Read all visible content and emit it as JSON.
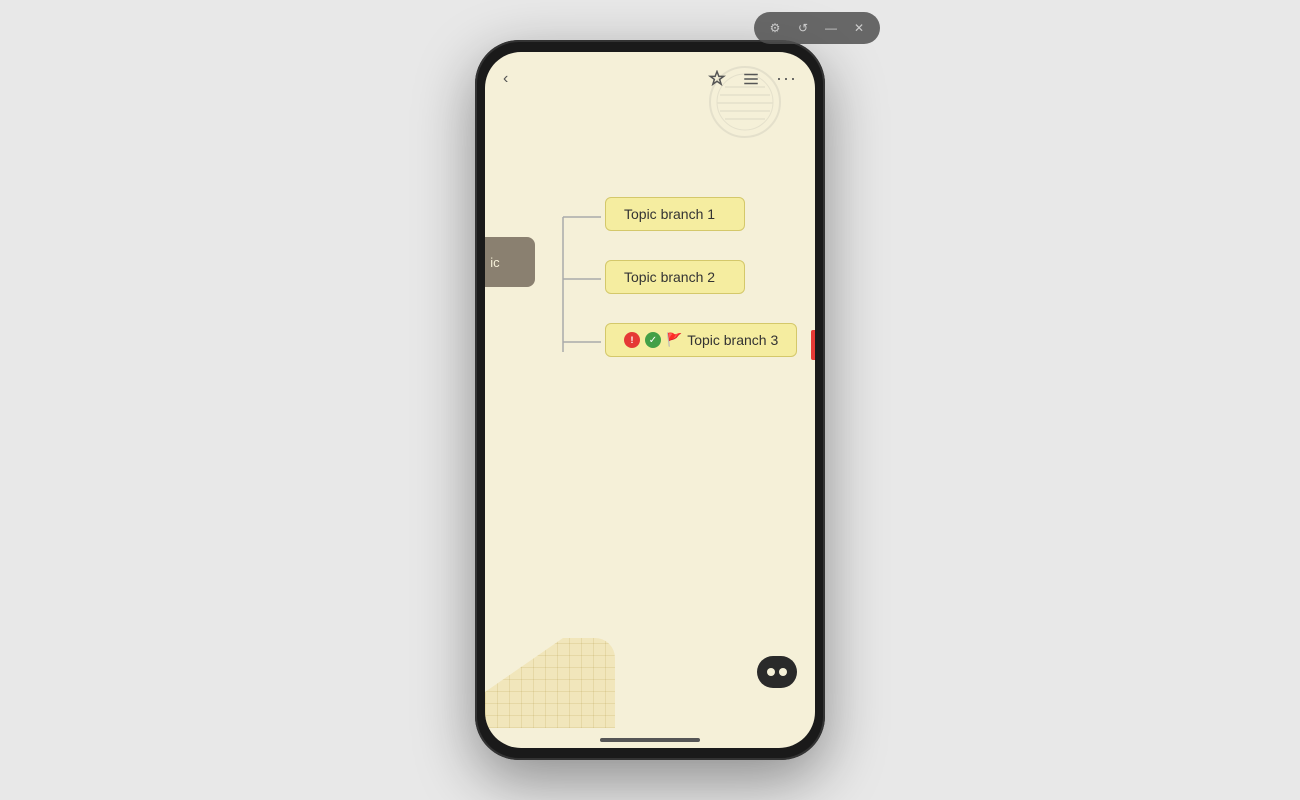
{
  "window": {
    "controls": {
      "settings_icon": "⚙",
      "history_icon": "↺",
      "minimize_icon": "—",
      "close_icon": "✕"
    }
  },
  "phone": {
    "topbar": {
      "back_icon": "‹",
      "pin_icon": "✦",
      "list_icon": "≡",
      "more_icon": "···"
    },
    "root": {
      "label": "ic"
    },
    "branches": [
      {
        "id": "b1",
        "label": "Topic branch 1",
        "badges": []
      },
      {
        "id": "b2",
        "label": "Topic branch 2",
        "badges": []
      },
      {
        "id": "b3",
        "label": "Topic branch 3",
        "badges": [
          "alert",
          "check",
          "flag"
        ]
      }
    ],
    "right_arrow": ">",
    "home_indicator": ""
  }
}
